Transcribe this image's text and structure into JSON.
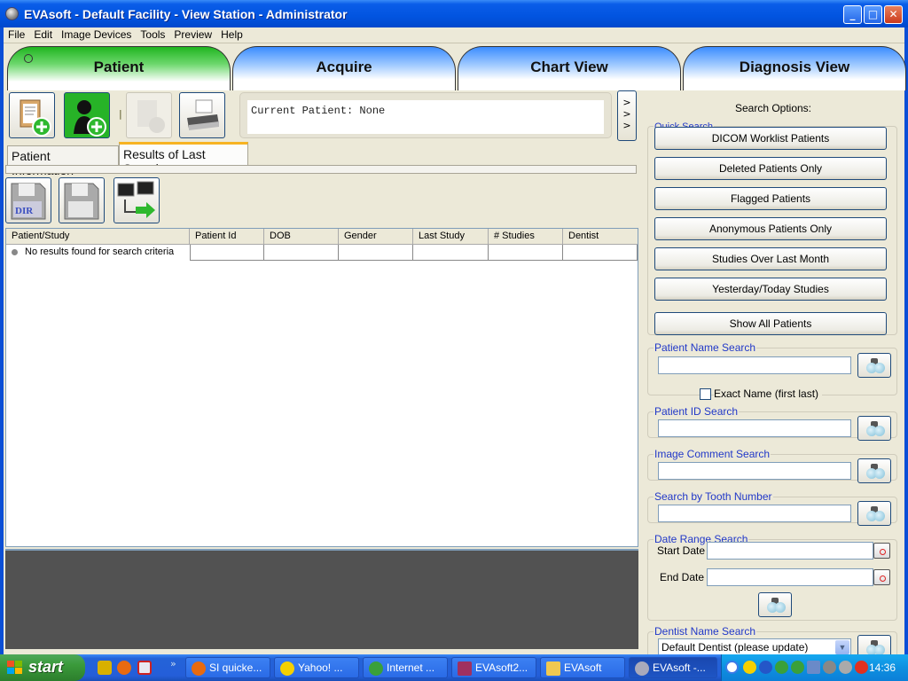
{
  "window": {
    "title": "EVAsoft - Default Facility - View Station - Administrator",
    "controls": {
      "minimize": "_",
      "maximize": "□",
      "close": "✕"
    }
  },
  "menu": [
    "File",
    "Edit",
    "Image Devices",
    "Tools",
    "Preview",
    "Help"
  ],
  "main_tabs": [
    {
      "label": "Patient",
      "active": true
    },
    {
      "label": "Acquire",
      "active": false
    },
    {
      "label": "Chart View",
      "active": false
    },
    {
      "label": "Diagnosis View",
      "active": false
    }
  ],
  "toolbar": {
    "buttons": [
      {
        "name": "new-patient-record",
        "icon": "clipboard-add-icon",
        "enabled": true
      },
      {
        "name": "add-patient",
        "icon": "person-add-icon",
        "enabled": true
      },
      {
        "name": "delete-patient",
        "icon": "delete-icon",
        "enabled": false
      },
      {
        "name": "print",
        "icon": "printer-icon",
        "enabled": true
      }
    ],
    "separator": "|"
  },
  "current_patient": "Current Patient: None",
  "expand_button": ">\n>\n>",
  "sub_tabs": [
    {
      "label": "Patient Information",
      "active": false
    },
    {
      "label": "Results of Last Search",
      "active": true
    }
  ],
  "results_toolbar": [
    {
      "name": "save-dir",
      "icon": "floppy-dir-icon",
      "text": "DIR"
    },
    {
      "name": "save",
      "icon": "floppy-icon"
    },
    {
      "name": "transfer",
      "icon": "computer-transfer-icon"
    }
  ],
  "table": {
    "columns": [
      "Patient/Study",
      "Patient Id",
      "DOB",
      "Gender",
      "Last Study",
      "# Studies",
      "Dentist"
    ],
    "rows": [
      [
        "No results found for search criteria",
        "",
        "",
        "",
        "",
        "",
        ""
      ]
    ]
  },
  "search": {
    "heading": "Search Options:",
    "quick_search_label": "Quick Search",
    "quick_buttons": [
      "DICOM Worklist Patients",
      "Deleted Patients Only",
      "Flagged Patients",
      "Anonymous Patients Only",
      "Studies Over Last Month",
      "Yesterday/Today Studies",
      "Show All Patients"
    ],
    "patient_name": {
      "label": "Patient Name Search",
      "value": "",
      "exact_label": "Exact Name (first last)",
      "exact_checked": false
    },
    "patient_id": {
      "label": "Patient ID Search",
      "value": ""
    },
    "image_comment": {
      "label": "Image Comment Search",
      "value": ""
    },
    "tooth_number": {
      "label": "Search by Tooth Number",
      "value": ""
    },
    "date_range": {
      "label": "Date Range Search",
      "start_label": "Start Date",
      "end_label": "End Date",
      "start_value": "",
      "end_value": ""
    },
    "dentist": {
      "label": "Dentist Name Search",
      "selected": "Default Dentist (please update)"
    }
  },
  "taskbar": {
    "start_label": "start",
    "overflow": "»",
    "tasks": [
      {
        "label": "SI quicke...",
        "icon": "firefox-icon",
        "active": false
      },
      {
        "label": "Yahoo! ...",
        "icon": "yahoo-messenger-icon",
        "active": false
      },
      {
        "label": "Internet ...",
        "icon": "internet-download-icon",
        "active": false
      },
      {
        "label": "EVAsoft2...",
        "icon": "winrar-icon",
        "active": false
      },
      {
        "label": "EVAsoft",
        "icon": "folder-icon",
        "active": false
      },
      {
        "label": "EVAsoft -...",
        "icon": "evasoft-icon",
        "active": true
      }
    ],
    "clock": "14:36"
  }
}
